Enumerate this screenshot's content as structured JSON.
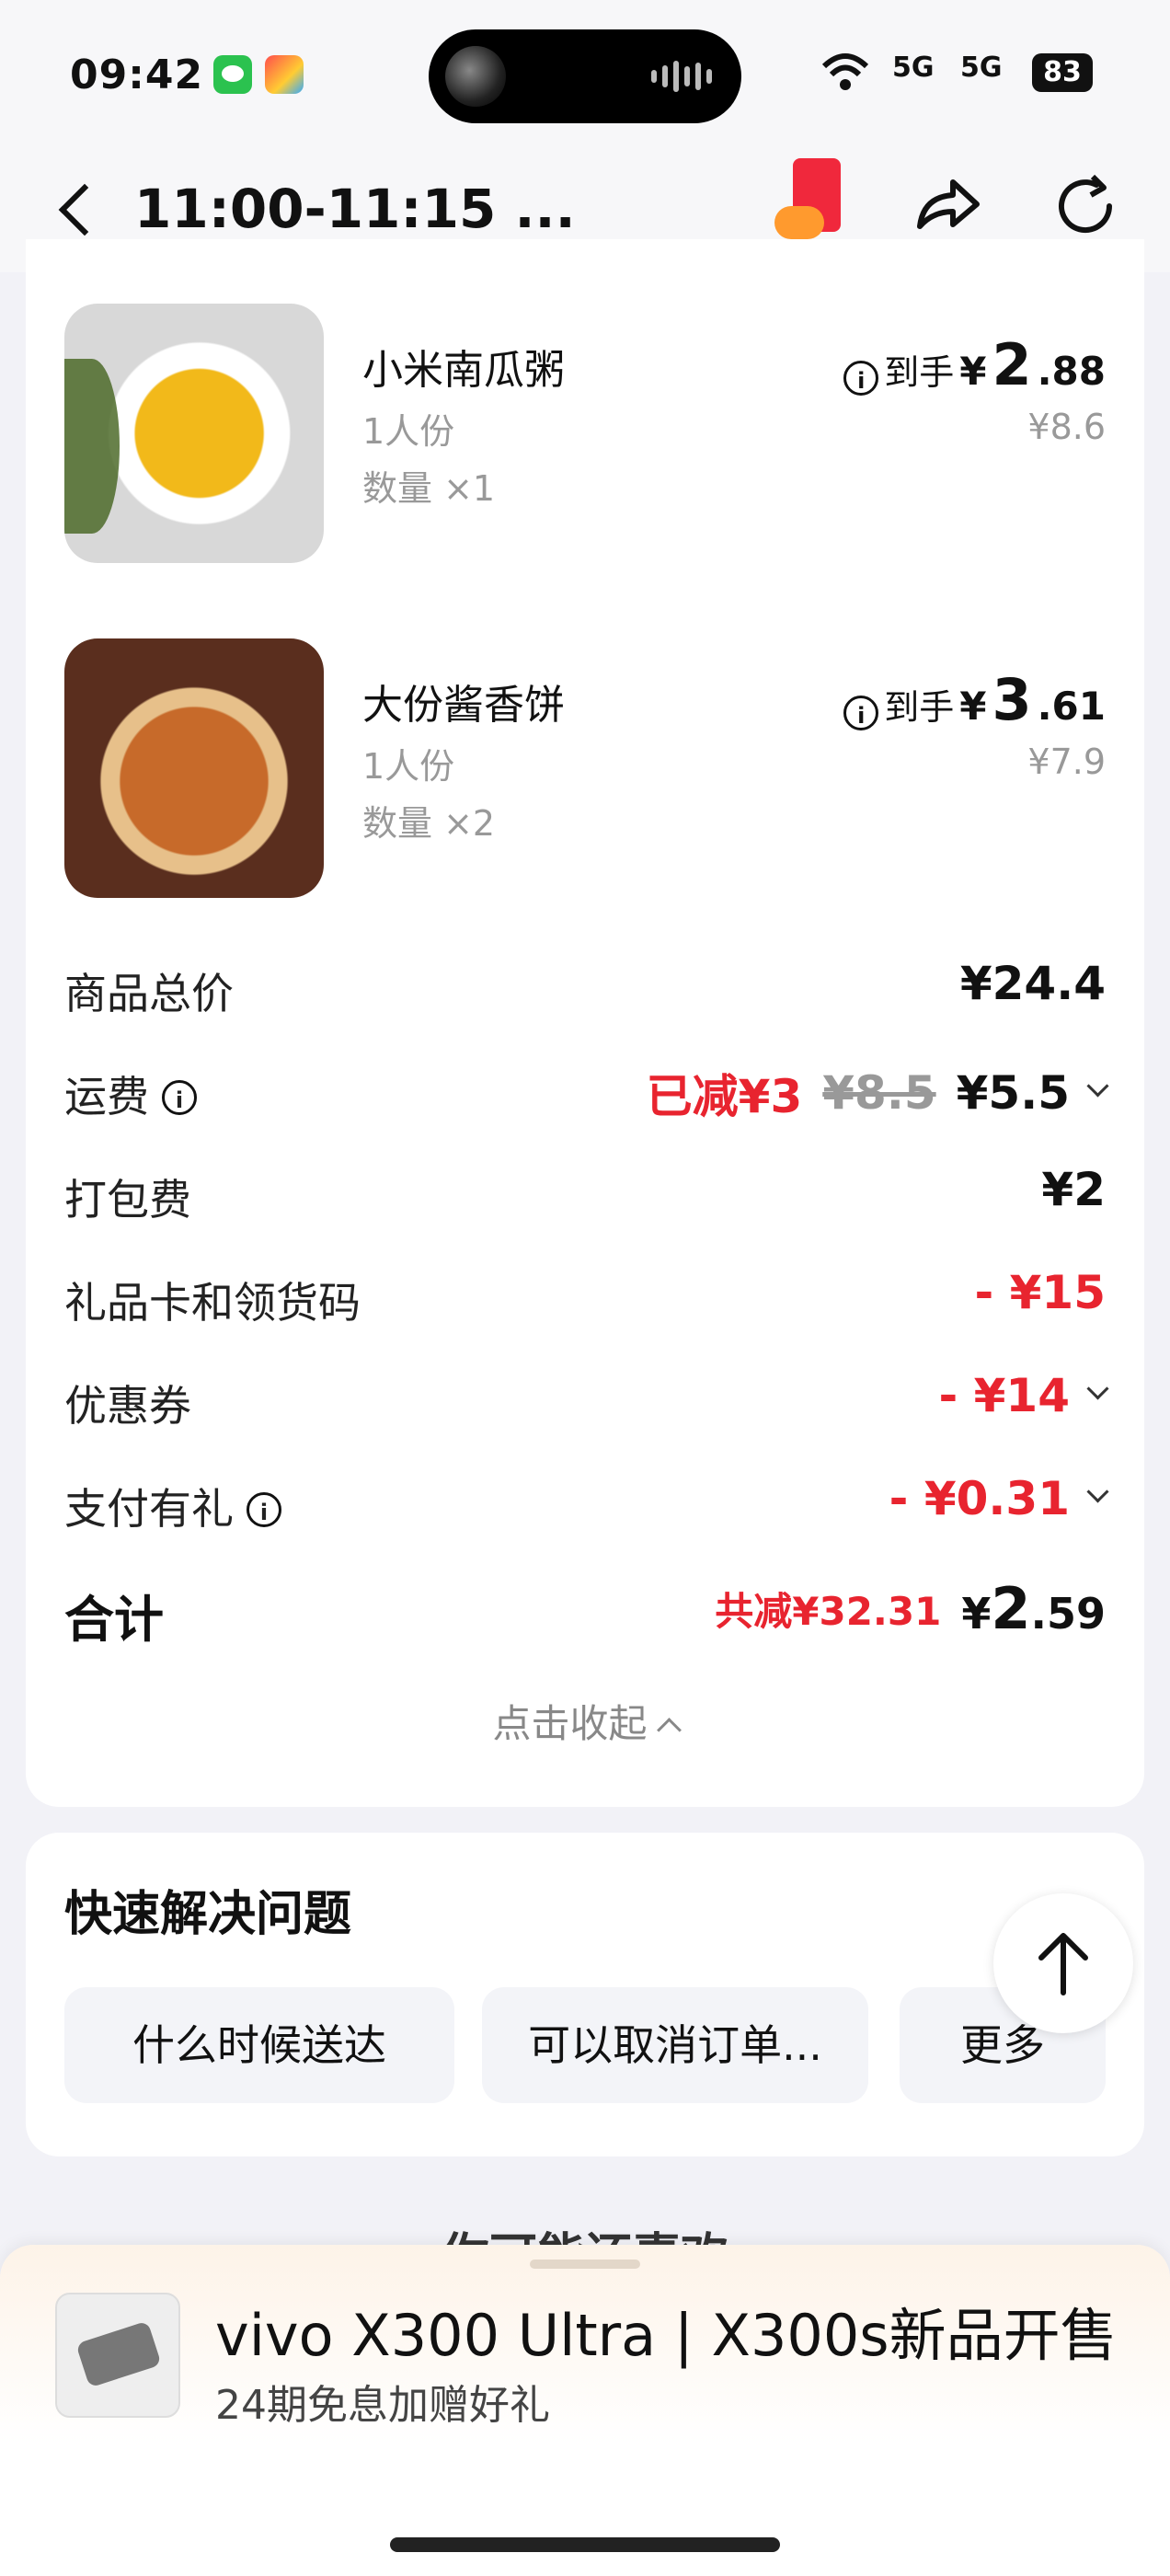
{
  "status_bar": {
    "time": "09:42",
    "net1": "5G",
    "net2": "5G",
    "battery": "83"
  },
  "header": {
    "title": "11:00-11:15 ..."
  },
  "items": [
    {
      "name": "小米南瓜粥",
      "spec": "1人份",
      "qty": "数量 ×1",
      "price_label": "到手",
      "yen": "¥",
      "price_int": "2",
      "price_dec": ".88",
      "original": "¥8.6"
    },
    {
      "name": "大份酱香饼",
      "spec": "1人份",
      "qty": "数量 ×2",
      "price_label": "到手",
      "yen": "¥",
      "price_int": "3",
      "price_dec": ".61",
      "original": "¥7.9"
    }
  ],
  "summary": {
    "subtotal_label": "商品总价",
    "subtotal": "¥24.4",
    "delivery_label": "运费",
    "delivery_discount": "已减¥3",
    "delivery_original": "¥8.5",
    "delivery": "¥5.5",
    "packing_label": "打包费",
    "packing": "¥2",
    "giftcard_label": "礼品卡和领货码",
    "giftcard": "- ¥15",
    "coupon_label": "优惠券",
    "coupon": "- ¥14",
    "paygift_label": "支付有礼",
    "paygift": "- ¥0.31",
    "total_label": "合计",
    "total_saving": "共减¥32.31",
    "total_yen": "¥",
    "total_int": "2",
    "total_dec": ".59",
    "collapse": "点击收起"
  },
  "help": {
    "title": "快速解决问题",
    "chips": [
      "什么时候送达",
      "可以取消订单...",
      "更多"
    ]
  },
  "recommend_title": "你可能还喜欢",
  "ad": {
    "title": "vivo X300 Ultra | X300s新品开售",
    "subtitle": "24期免息加赠好礼"
  },
  "colors": {
    "accent_red": "#e8242f",
    "muted": "#999999"
  }
}
